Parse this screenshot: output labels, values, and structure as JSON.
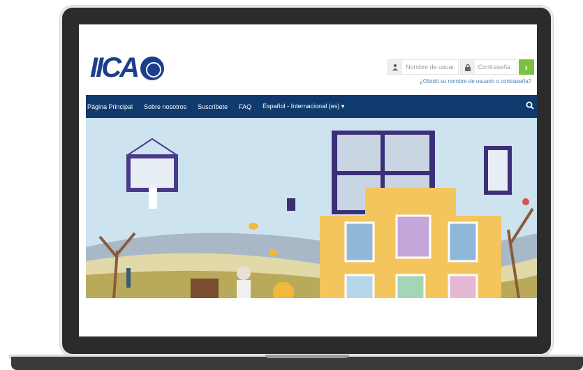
{
  "brand": {
    "logo_text": "IICA"
  },
  "login": {
    "username_placeholder": "Nombre de usuar",
    "password_placeholder": "Contraseña",
    "submit_icon": "chevron-right-icon",
    "forgot_link": "¿Olvidó su nombre de usuario o contraseña?"
  },
  "nav": {
    "items": [
      "Página Principal",
      "Sobre nosotros",
      "Suscríbete",
      "FAQ",
      "Español - Internacional (es) ▾"
    ],
    "search_icon": "search-icon"
  },
  "colors": {
    "brand_blue": "#1c3f8c",
    "nav_bg": "#103a6e",
    "go_green": "#7ac142",
    "link_blue": "#4a7fb5",
    "building_yellow": "#f4c55c"
  }
}
